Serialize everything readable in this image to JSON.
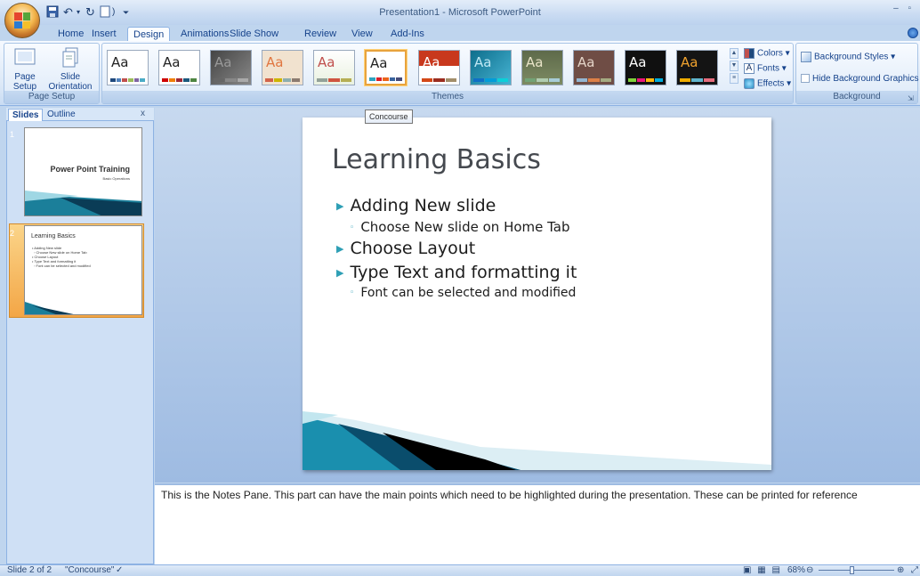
{
  "window": {
    "title": "Presentation1 - Microsoft PowerPoint"
  },
  "tabs": [
    {
      "label": "Home"
    },
    {
      "label": "Insert"
    },
    {
      "label": "Design"
    },
    {
      "label": "Animations"
    },
    {
      "label": "Slide Show"
    },
    {
      "label": "Review"
    },
    {
      "label": "View"
    },
    {
      "label": "Add-Ins"
    }
  ],
  "active_tab": "Design",
  "ribbon": {
    "page_setup": {
      "page_setup_label": "Page Setup",
      "slide_orientation_label": "Slide Orientation",
      "group_label": "Page Setup"
    },
    "themes": {
      "group_label": "Themes",
      "thumb_text": "Aa",
      "selected_tooltip": "Concourse",
      "colors_label": "Colors",
      "fonts_label": "Fonts",
      "effects_label": "Effects"
    },
    "background": {
      "styles_label": "Background Styles",
      "hide_graphics_label": "Hide Background Graphics",
      "group_label": "Background"
    }
  },
  "left_pane": {
    "tabs": [
      {
        "label": "Slides"
      },
      {
        "label": "Outline"
      }
    ],
    "close": "x",
    "slides": [
      {
        "number": "1",
        "title": "Power Point Training",
        "subtitle": "Basic Operations"
      },
      {
        "number": "2",
        "title": "Learning Basics",
        "lines": [
          "• Adding New slide",
          "◦ Choose New slide on Home Tab",
          "• Choose Layout",
          "• Type Text and formatting it",
          "◦ Font can be selected and modified"
        ]
      }
    ]
  },
  "slide": {
    "title": "Learning Basics",
    "bullets": [
      {
        "level": 1,
        "text": "Adding New slide"
      },
      {
        "level": 2,
        "text": "Choose New slide on Home Tab"
      },
      {
        "level": 1,
        "text": "Choose Layout"
      },
      {
        "level": 1,
        "text": "Type Text and formatting it"
      },
      {
        "level": 2,
        "text": "Font can be selected and modified"
      }
    ]
  },
  "notes": {
    "text": "This is the Notes Pane. This part can have the main points which need to be highlighted during the presentation. These can be printed for reference"
  },
  "status": {
    "slide_position": "Slide 2 of 2",
    "theme_name": "\"Concourse\"",
    "zoom": "68%"
  },
  "colors": {
    "accent_teal": "#2e9fb5",
    "selection_orange": "#f3a646",
    "ribbon_blue": "#bfd5ee"
  }
}
